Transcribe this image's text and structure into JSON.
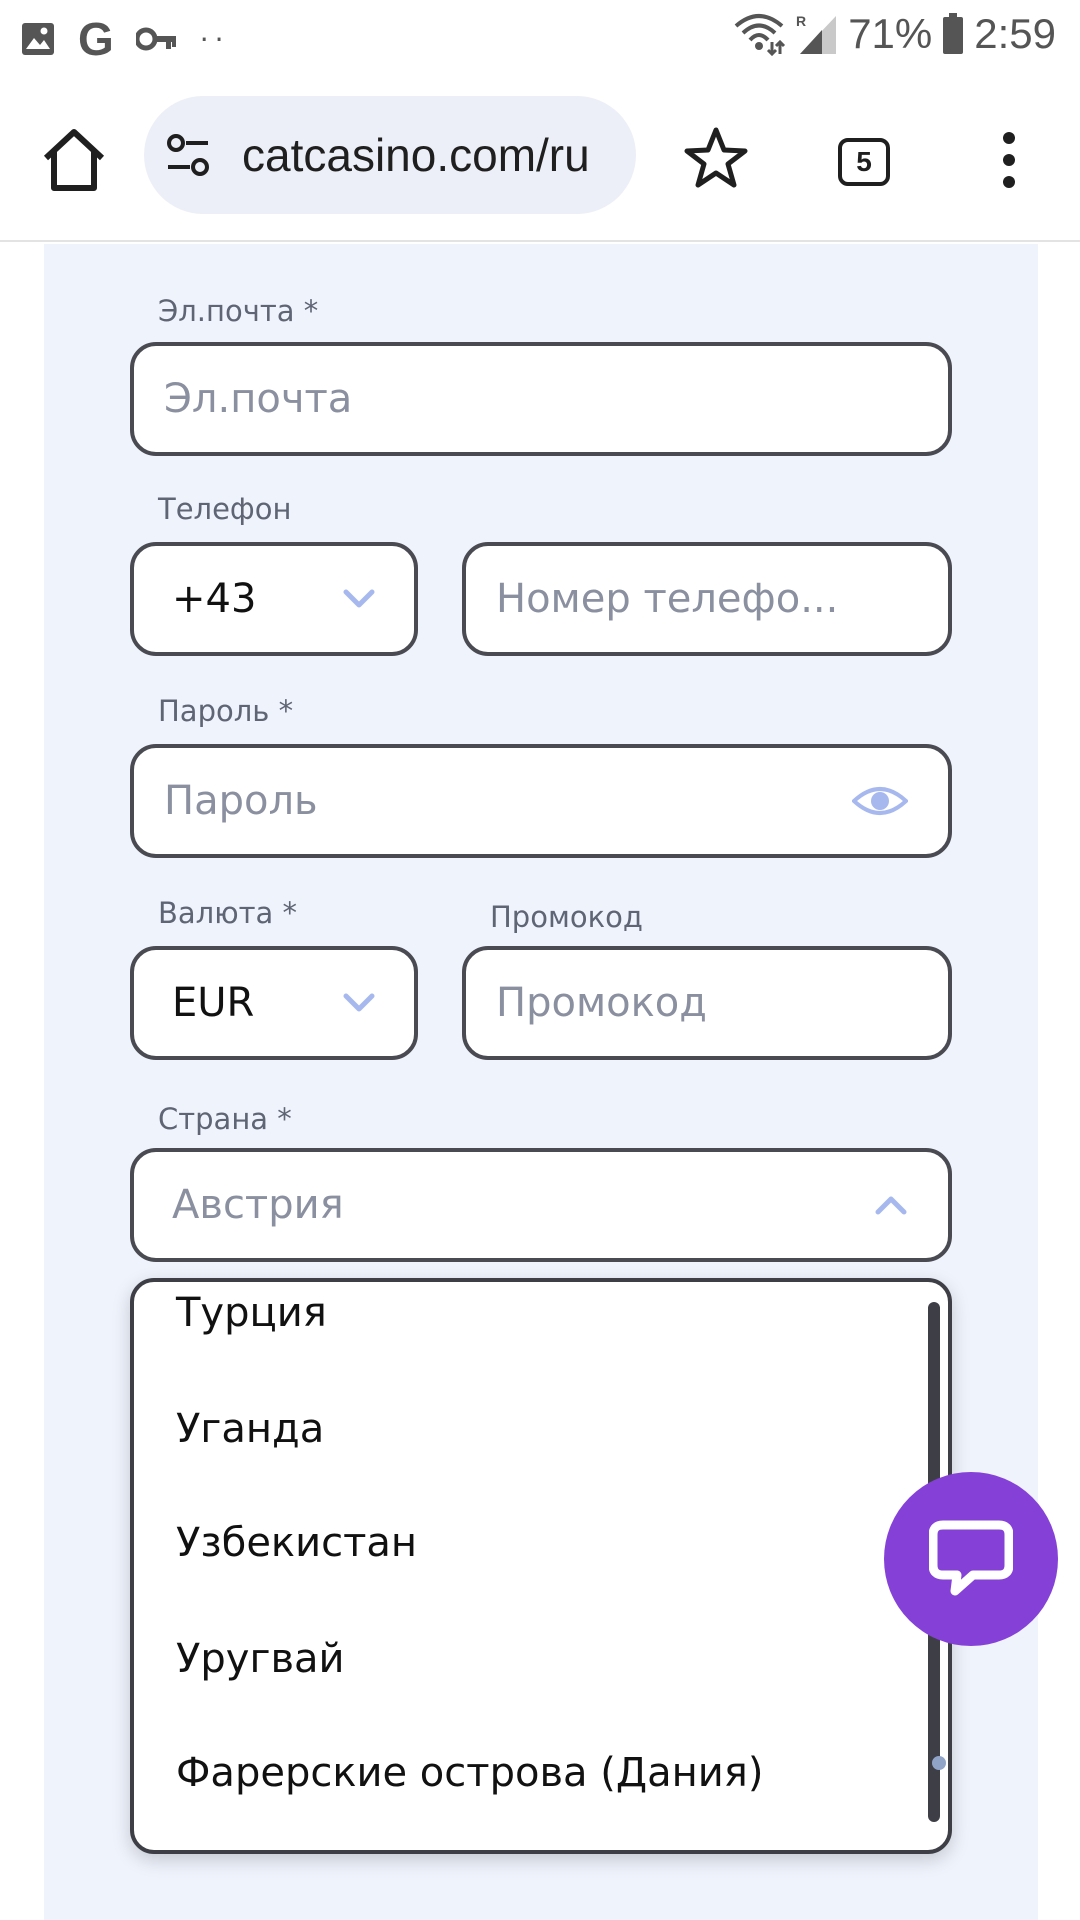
{
  "status_bar": {
    "google_letter": "G",
    "more_dots": "··",
    "roaming_mark": "R",
    "battery_percent": "71%",
    "time": "2:59",
    "left_icons": [
      "image-icon",
      "google-icon",
      "key-icon",
      "more-notifications-icon"
    ],
    "right_icons": [
      "wifi-icon",
      "signal-icon",
      "battery-icon"
    ]
  },
  "browser": {
    "url": "catcasino.com/ru",
    "tab_count": "5",
    "icons": [
      "home-icon",
      "site-settings-icon",
      "star-icon",
      "tabs-icon",
      "more-vert-icon"
    ]
  },
  "form": {
    "email": {
      "label": "Эл.почта *",
      "placeholder": "Эл.почта"
    },
    "phone": {
      "label": "Телефон",
      "code": "+43",
      "placeholder": "Номер телефо..."
    },
    "password": {
      "label": "Пароль *",
      "placeholder": "Пароль"
    },
    "currency": {
      "label": "Валюта *",
      "value": "EUR"
    },
    "promo": {
      "label": "Промокод",
      "placeholder": "Промокод"
    },
    "country": {
      "label": "Страна *",
      "value": "Австрия",
      "options": [
        "Турция",
        "Уганда",
        "Узбекистан",
        "Уругвай",
        "Фарерские острова (Дания)"
      ]
    }
  },
  "colors": {
    "card_background": "#eff3fc",
    "field_border": "#4a4b52",
    "chevron": "#a7b8ee",
    "chat_fab": "#8540d8"
  }
}
